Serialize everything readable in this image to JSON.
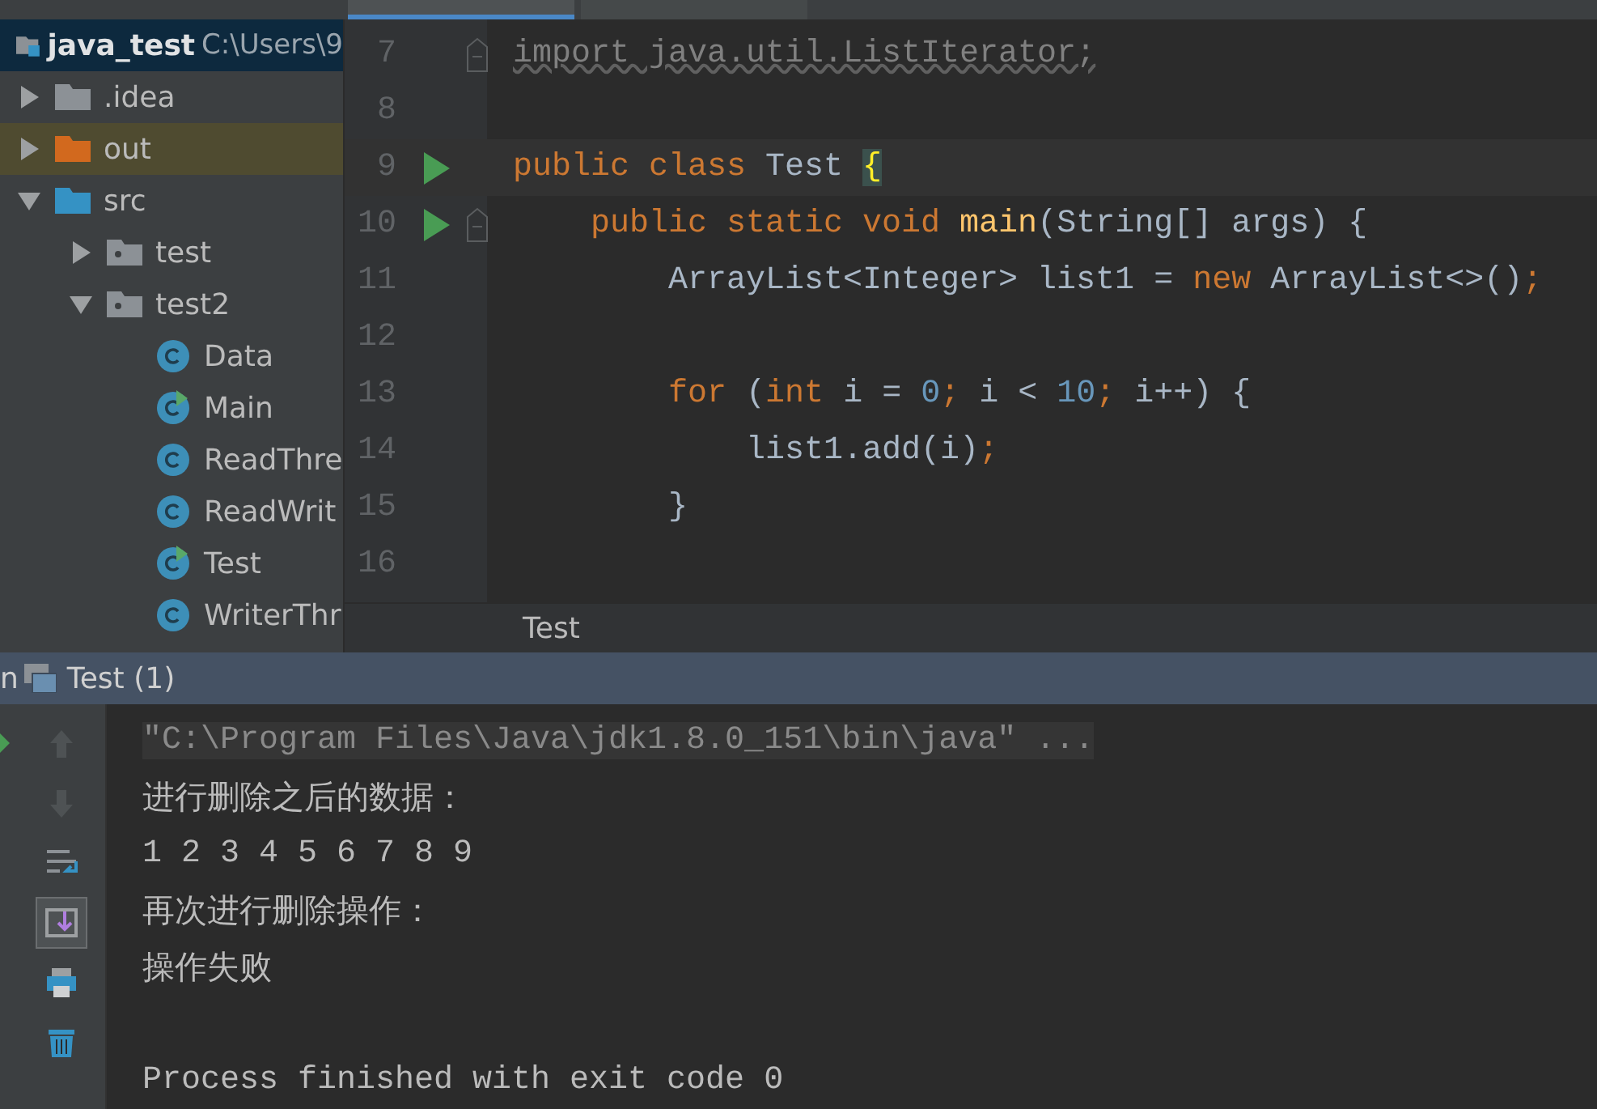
{
  "project": {
    "root": {
      "name": "java_test",
      "path": "C:\\Users\\9"
    },
    "tree": [
      {
        "name": ".idea",
        "kind": "folder",
        "color": "#8c9196",
        "expanded": false,
        "highlighted": false
      },
      {
        "name": "out",
        "kind": "folder",
        "color": "#d2691e",
        "expanded": false,
        "highlighted": true
      },
      {
        "name": "src",
        "kind": "folder",
        "color": "#3592c4",
        "expanded": true,
        "highlighted": false,
        "children": [
          {
            "name": "test",
            "kind": "package",
            "expanded": false,
            "highlighted": false
          },
          {
            "name": "test2",
            "kind": "package",
            "expanded": true,
            "highlighted": false,
            "children": [
              {
                "name": "Data",
                "kind": "class",
                "runnable": false,
                "highlighted": false
              },
              {
                "name": "Main",
                "kind": "class",
                "runnable": true,
                "highlighted": false
              },
              {
                "name": "ReadThre",
                "kind": "class",
                "runnable": false,
                "highlighted": false
              },
              {
                "name": "ReadWrit",
                "kind": "class",
                "runnable": false,
                "highlighted": false
              },
              {
                "name": "Test",
                "kind": "class",
                "runnable": true,
                "highlighted": false
              },
              {
                "name": "WriterThr",
                "kind": "class",
                "runnable": false,
                "highlighted": false
              }
            ]
          }
        ]
      }
    ]
  },
  "editor": {
    "lines": [
      {
        "number": "7",
        "fold": true,
        "tokens": [
          {
            "text": "import java.util.ListIterator;",
            "kind": "unused"
          }
        ]
      },
      {
        "number": "8"
      },
      {
        "number": "9",
        "run_marker": true,
        "tokens": [
          {
            "text": "public class ",
            "kind": "keyword"
          },
          {
            "text": "Test ",
            "kind": "plain"
          },
          {
            "text": "{",
            "kind": "brace"
          }
        ]
      },
      {
        "number": "10",
        "run_marker": true,
        "fold": true,
        "tokens": [
          {
            "text": "    public static void ",
            "kind": "keyword"
          },
          {
            "text": "main",
            "kind": "method"
          },
          {
            "text": "(String[] args) {",
            "kind": "plain"
          }
        ]
      },
      {
        "number": "11",
        "tokens": [
          {
            "text": "        ArrayList<Integer> list1 = ",
            "kind": "plain"
          },
          {
            "text": "new ",
            "kind": "keyword"
          },
          {
            "text": "ArrayList<>()",
            "kind": "plain"
          },
          {
            "text": ";",
            "kind": "keyword"
          }
        ]
      },
      {
        "number": "12"
      },
      {
        "number": "13",
        "tokens": [
          {
            "text": "        for ",
            "kind": "keyword"
          },
          {
            "text": "(",
            "kind": "plain"
          },
          {
            "text": "int ",
            "kind": "keyword"
          },
          {
            "text": "i = ",
            "kind": "plain"
          },
          {
            "text": "0",
            "kind": "number"
          },
          {
            "text": "; ",
            "kind": "keyword"
          },
          {
            "text": "i < ",
            "kind": "plain"
          },
          {
            "text": "10",
            "kind": "number"
          },
          {
            "text": "; ",
            "kind": "keyword"
          },
          {
            "text": "i++) {",
            "kind": "plain"
          }
        ]
      },
      {
        "number": "14",
        "tokens": [
          {
            "text": "            list1.add(i)",
            "kind": "plain"
          },
          {
            "text": ";",
            "kind": "keyword"
          }
        ]
      },
      {
        "number": "15",
        "tokens": [
          {
            "text": "        }",
            "kind": "plain"
          }
        ]
      },
      {
        "number": "16"
      }
    ],
    "breadcrumb": "Test"
  },
  "run_panel": {
    "label": "n",
    "tab": "Test (1)",
    "toolbar": [
      {
        "kind": "up",
        "disabled": true,
        "selected": false
      },
      {
        "kind": "down",
        "disabled": true,
        "selected": false
      },
      {
        "kind": "wrap",
        "selected": false
      },
      {
        "kind": "scroll-end",
        "selected": true
      },
      {
        "kind": "print",
        "selected": false
      },
      {
        "kind": "trash",
        "selected": false
      }
    ],
    "console": [
      {
        "text": "\"C:\\Program Files\\Java\\jdk1.8.0_151\\bin\\java\" ...",
        "kind": "command"
      },
      {
        "text": "进行删除之后的数据：",
        "kind": "output"
      },
      {
        "text": "1 2 3 4 5 6 7 8 9",
        "kind": "output"
      },
      {
        "text": "再次进行删除操作：",
        "kind": "output"
      },
      {
        "text": "操作失败",
        "kind": "output"
      },
      {
        "kind": "blank"
      },
      {
        "text": "Process finished with exit code 0",
        "kind": "output"
      }
    ]
  }
}
